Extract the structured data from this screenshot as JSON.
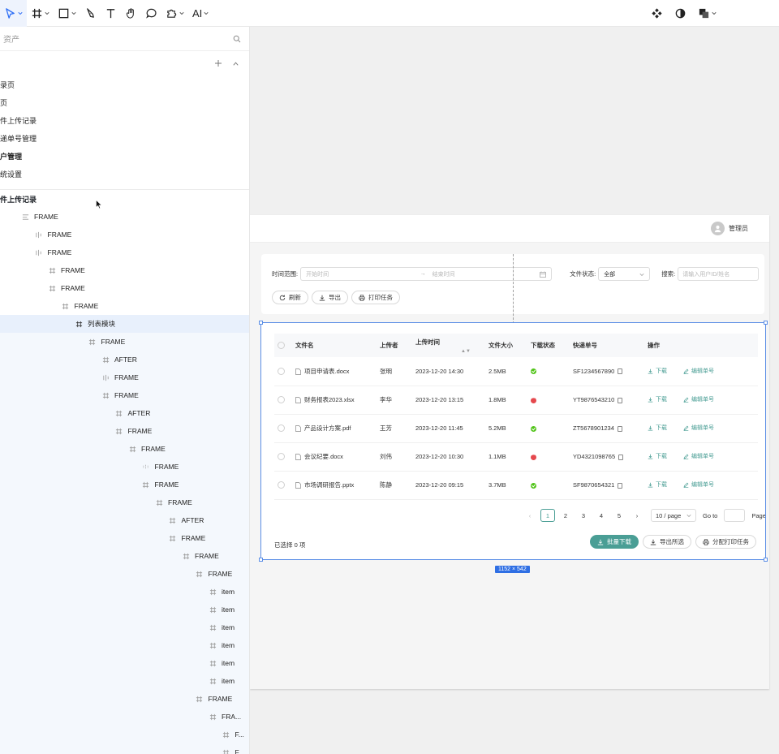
{
  "toolbar": {
    "tools": [
      "select-tool",
      "frame-tool",
      "shape-tool",
      "pen-tool",
      "text-tool",
      "hand-tool",
      "comment-tool",
      "plugin-tool"
    ],
    "ai_label": "AI"
  },
  "assets": {
    "search_placeholder": "资产"
  },
  "pages": [
    {
      "label": "录页",
      "bold": false
    },
    {
      "label": "页",
      "bold": false
    },
    {
      "label": "件上传记录",
      "bold": false
    },
    {
      "label": "递单号管理",
      "bold": false
    },
    {
      "label": "户管理",
      "bold": true
    },
    {
      "label": "统设置",
      "bold": false
    }
  ],
  "layers": {
    "title": "件上传记录",
    "items": [
      {
        "label": "FRAME",
        "depth": 0,
        "icon": "stack"
      },
      {
        "label": "FRAME",
        "depth": 1,
        "icon": "columns"
      },
      {
        "label": "FRAME",
        "depth": 1,
        "icon": "columns"
      },
      {
        "label": "FRAME",
        "depth": 2,
        "icon": "frame"
      },
      {
        "label": "FRAME",
        "depth": 2,
        "icon": "frame"
      },
      {
        "label": "FRAME",
        "depth": 3,
        "icon": "frame"
      },
      {
        "label": "列表模块",
        "depth": 4,
        "icon": "frame",
        "selected": true
      },
      {
        "label": "FRAME",
        "depth": 5,
        "icon": "frame"
      },
      {
        "label": "AFTER",
        "depth": 6,
        "icon": "frame"
      },
      {
        "label": "FRAME",
        "depth": 6,
        "icon": "columns"
      },
      {
        "label": "FRAME",
        "depth": 6,
        "icon": "frame"
      },
      {
        "label": "AFTER",
        "depth": 7,
        "icon": "frame"
      },
      {
        "label": "FRAME",
        "depth": 7,
        "icon": "frame"
      },
      {
        "label": "FRAME",
        "depth": 8,
        "icon": "frame"
      },
      {
        "label": "FRAME",
        "depth": 9,
        "icon": "dots"
      },
      {
        "label": "FRAME",
        "depth": 9,
        "icon": "frame"
      },
      {
        "label": "FRAME",
        "depth": 10,
        "icon": "frame"
      },
      {
        "label": "AFTER",
        "depth": 11,
        "icon": "frame"
      },
      {
        "label": "FRAME",
        "depth": 11,
        "icon": "frame"
      },
      {
        "label": "FRAME",
        "depth": 12,
        "icon": "frame"
      },
      {
        "label": "FRAME",
        "depth": 13,
        "icon": "frame"
      },
      {
        "label": "item",
        "depth": 14,
        "icon": "frame"
      },
      {
        "label": "item",
        "depth": 14,
        "icon": "frame"
      },
      {
        "label": "item",
        "depth": 14,
        "icon": "frame"
      },
      {
        "label": "item",
        "depth": 14,
        "icon": "frame"
      },
      {
        "label": "item",
        "depth": 14,
        "icon": "frame"
      },
      {
        "label": "item",
        "depth": 14,
        "icon": "frame"
      },
      {
        "label": "FRAME",
        "depth": 13,
        "icon": "frame"
      },
      {
        "label": "FRA...",
        "depth": 14,
        "icon": "frame"
      },
      {
        "label": "F...",
        "depth": 15,
        "icon": "frame"
      },
      {
        "label": "F...",
        "depth": 15,
        "icon": "frame"
      }
    ]
  },
  "app_header": {
    "user_name": "管理员"
  },
  "filters": {
    "time_label": "时间范围:",
    "start_placeholder": "开始时间",
    "arrow": "→",
    "end_placeholder": "结束时间",
    "status_label": "文件状态:",
    "status_value": "全部",
    "search_label": "搜索:",
    "search_placeholder": "请输入用户ID/姓名",
    "refresh": "刷新",
    "export": "导出",
    "print_task": "打印任务"
  },
  "table": {
    "headers": [
      "文件名",
      "上传者",
      "上传时间",
      "文件大小",
      "下载状态",
      "快递单号",
      "操作"
    ],
    "rows": [
      {
        "file": "项目申请表.docx",
        "uploader": "张明",
        "time": "2023-12-20 14:30",
        "size": "2.5MB",
        "status": "success",
        "tracking": "SF1234567890"
      },
      {
        "file": "财务报表2023.xlsx",
        "uploader": "李华",
        "time": "2023-12-20 13:15",
        "size": "1.8MB",
        "status": "fail",
        "tracking": "YT9876543210"
      },
      {
        "file": "产品设计方案.pdf",
        "uploader": "王芳",
        "time": "2023-12-20 11:45",
        "size": "5.2MB",
        "status": "success",
        "tracking": "ZT5678901234"
      },
      {
        "file": "会议纪要.docx",
        "uploader": "刘伟",
        "time": "2023-12-20 10:30",
        "size": "1.1MB",
        "status": "fail",
        "tracking": "YD4321098765"
      },
      {
        "file": "市场调研报告.pptx",
        "uploader": "陈静",
        "time": "2023-12-20 09:15",
        "size": "3.7MB",
        "status": "success",
        "tracking": "SF9870654321"
      }
    ],
    "op_download": "下载",
    "op_edit": "编辑单号"
  },
  "pagination": {
    "pages": [
      "1",
      "2",
      "3",
      "4",
      "5"
    ],
    "page_size": "10 / page",
    "goto": "Go to",
    "page_word": "Page"
  },
  "footer": {
    "selected": "已选择 0 项",
    "batch_download": "批量下载",
    "export_selected": "导出所选",
    "assign_print": "分配打印任务"
  },
  "selection": {
    "dimensions": "1152 × 542"
  },
  "colors": {
    "accent": "#4a9e95",
    "success": "#52c41a",
    "fail": "#e5484d",
    "selection": "#5b8ee6",
    "tool_active": "#2d6ef6"
  }
}
